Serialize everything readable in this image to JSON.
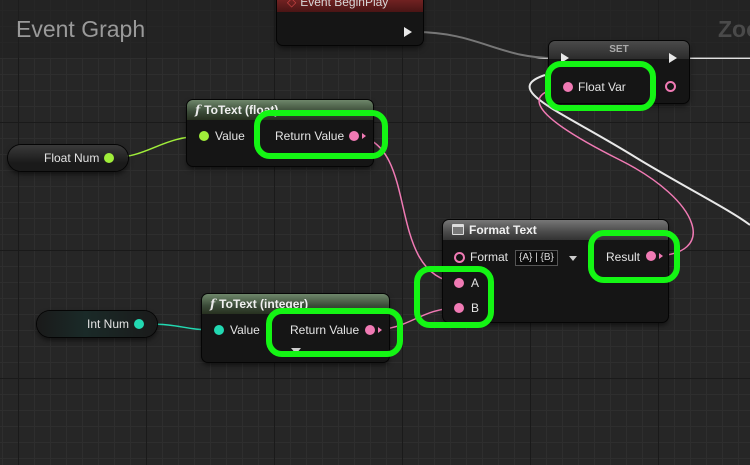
{
  "header": {
    "graph_title": "Event Graph",
    "zoom_text": "Zoo"
  },
  "event_begin_play": {
    "title": "Event BeginPlay"
  },
  "set_node": {
    "title": "SET",
    "pin_float_var": "Float Var"
  },
  "float_num_var": {
    "label": "Float Num"
  },
  "int_num_var": {
    "label": "Int Num"
  },
  "to_text_float": {
    "title": "ToText (float)",
    "input_label": "Value",
    "output_label": "Return Value"
  },
  "to_text_integer": {
    "title": "ToText (integer)",
    "input_label": "Value",
    "output_label": "Return Value"
  },
  "format_text": {
    "title": "Format Text",
    "format_label": "Format",
    "format_value": "{A} | {B}",
    "pin_a": "A",
    "pin_b": "B",
    "result_label": "Result"
  },
  "colors": {
    "highlight": "#14f514",
    "float_pin": "#a0ee3a",
    "text_pin": "#f07ab4",
    "int_pin": "#22d9b2",
    "exec_wire": "#e8e8e8"
  },
  "icons": {
    "function": "function-icon",
    "format_text": "format-text-icon",
    "event": "event-icon"
  }
}
